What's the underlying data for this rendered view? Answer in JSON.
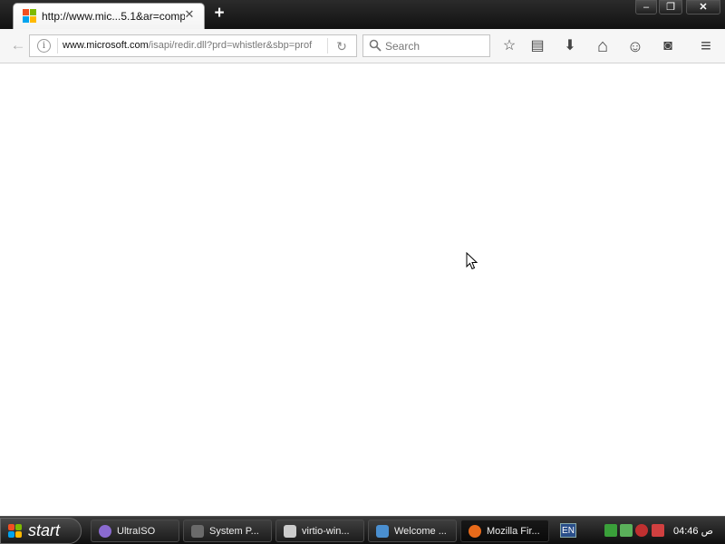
{
  "browser": {
    "tab": {
      "title": "http://www.mic...5.1&ar=compat",
      "close_symbol": "✕",
      "favicon": "microsoft-logo-icon"
    },
    "new_tab_symbol": "+",
    "window_buttons": {
      "minimize": "–",
      "maximize": "❐",
      "close": "✕"
    }
  },
  "navbar": {
    "back_symbol": "←",
    "url_host": "www.microsoft.com",
    "url_rest": "/isapi/redir.dll?prd=whistler&sbp=prof",
    "reload_symbol": "↻",
    "search_placeholder": "Search",
    "icons": {
      "bookmark": "☆",
      "reading_list": "▤",
      "downloads": "⬇",
      "home": "⌂",
      "hello": "☺",
      "pocket": "◙",
      "menu": "≡"
    }
  },
  "taskbar": {
    "start_label": "start",
    "tasks": [
      {
        "label": "UltraISO",
        "icon": "ultraiso-icon",
        "color": "#8a6ad0"
      },
      {
        "label": "System P...",
        "icon": "system-properties-icon",
        "color": "#6a6a6a"
      },
      {
        "label": "virtio-win...",
        "icon": "drive-icon",
        "color": "#cccccc"
      },
      {
        "label": "Welcome ...",
        "icon": "welcome-icon",
        "color": "#4a8fd0"
      },
      {
        "label": "Mozilla Fir...",
        "icon": "firefox-icon",
        "color": "#e86a1a"
      }
    ],
    "tray": {
      "language": "EN",
      "clock": "04:46 ص"
    }
  },
  "colors": {
    "ms_red": "#f25022",
    "ms_green": "#7fba00",
    "ms_blue": "#00a4ef",
    "ms_yellow": "#ffb900"
  }
}
